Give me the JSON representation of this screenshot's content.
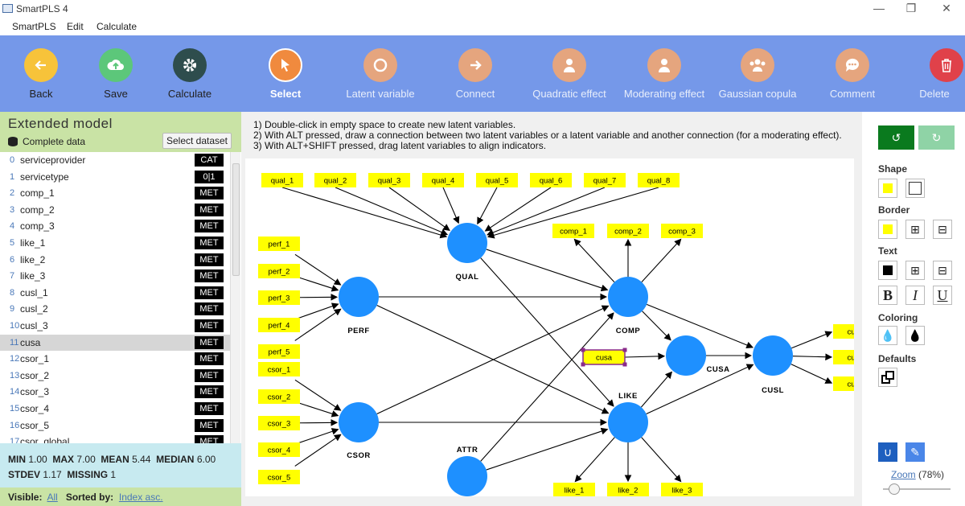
{
  "window": {
    "title": "SmartPLS 4"
  },
  "menu": [
    "SmartPLS",
    "Edit",
    "Calculate"
  ],
  "toolbar": {
    "back": "Back",
    "save": "Save",
    "calculate": "Calculate",
    "select": "Select",
    "latent": "Latent variable",
    "connect": "Connect",
    "quadratic": "Quadratic effect",
    "moderating": "Moderating effect",
    "copula": "Gaussian copula",
    "comment": "Comment",
    "delete": "Delete"
  },
  "left": {
    "title": "Extended model",
    "dataset": "Complete data",
    "select_dataset": "Select dataset",
    "variables": [
      {
        "i": "0",
        "name": "serviceprovider",
        "type": "CAT"
      },
      {
        "i": "1",
        "name": "servicetype",
        "type": "0|1"
      },
      {
        "i": "2",
        "name": "comp_1",
        "type": "MET"
      },
      {
        "i": "3",
        "name": "comp_2",
        "type": "MET"
      },
      {
        "i": "4",
        "name": "comp_3",
        "type": "MET"
      },
      {
        "i": "5",
        "name": "like_1",
        "type": "MET"
      },
      {
        "i": "6",
        "name": "like_2",
        "type": "MET"
      },
      {
        "i": "7",
        "name": "like_3",
        "type": "MET"
      },
      {
        "i": "8",
        "name": "cusl_1",
        "type": "MET"
      },
      {
        "i": "9",
        "name": "cusl_2",
        "type": "MET"
      },
      {
        "i": "10",
        "name": "cusl_3",
        "type": "MET"
      },
      {
        "i": "11",
        "name": "cusa",
        "type": "MET"
      },
      {
        "i": "12",
        "name": "csor_1",
        "type": "MET"
      },
      {
        "i": "13",
        "name": "csor_2",
        "type": "MET"
      },
      {
        "i": "14",
        "name": "csor_3",
        "type": "MET"
      },
      {
        "i": "15",
        "name": "csor_4",
        "type": "MET"
      },
      {
        "i": "16",
        "name": "csor_5",
        "type": "MET"
      },
      {
        "i": "17",
        "name": "csor_global",
        "type": "MET"
      }
    ],
    "stats": {
      "min_label": "MIN",
      "min": "1.00",
      "max_label": "MAX",
      "max": "7.00",
      "mean_label": "MEAN",
      "mean": "5.44",
      "median_label": "MEDIAN",
      "median": "6.00",
      "stdev_label": "STDEV",
      "stdev": "1.17",
      "missing_label": "MISSING",
      "missing": "1"
    },
    "footer": {
      "visible_label": "Visible:",
      "visible": "All",
      "sorted_label": "Sorted by:",
      "sorted": "Index asc."
    }
  },
  "instructions": [
    "1) Double-click in empty space to create new latent variables.",
    "2) With ALT pressed, draw a connection between two latent variables or a latent variable and another connection (for a moderating effect).",
    "3) With ALT+SHIFT pressed, drag latent variables to align indicators."
  ],
  "model": {
    "constructs": [
      "QUAL",
      "PERF",
      "COMP",
      "CUSA",
      "CUSL",
      "LIKE",
      "CSOR",
      "ATTR"
    ],
    "indicators": [
      "qual_1",
      "qual_2",
      "qual_3",
      "qual_4",
      "qual_5",
      "qual_6",
      "qual_7",
      "qual_8",
      "comp_1",
      "comp_2",
      "comp_3",
      "perf_1",
      "perf_2",
      "perf_3",
      "perf_4",
      "perf_5",
      "csor_1",
      "csor_2",
      "csor_3",
      "csor_4",
      "csor_5",
      "cusa",
      "cusl",
      "cusl",
      "cusl",
      "like_1",
      "like_2",
      "like_3"
    ]
  },
  "right": {
    "shape": "Shape",
    "border": "Border",
    "text": "Text",
    "coloring": "Coloring",
    "defaults": "Defaults",
    "zoom_label": "Zoom",
    "zoom_value": "(78%)"
  },
  "colors": {
    "toolbar": "#7598e9",
    "node": "#1e90ff",
    "indicator": "#ffff00",
    "left_header": "#c9e3a5",
    "stats_bg": "#c7eaf0"
  }
}
